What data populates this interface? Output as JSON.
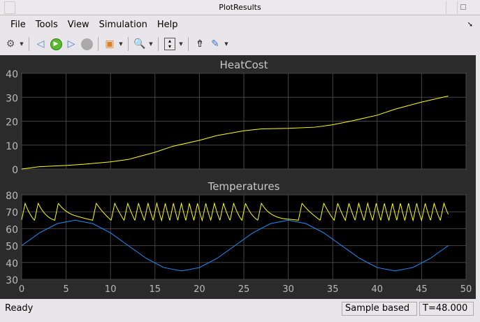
{
  "window": {
    "title": "PlotResults"
  },
  "menu": [
    "File",
    "Tools",
    "View",
    "Simulation",
    "Help"
  ],
  "toolbar": {
    "icons": [
      "gear-icon",
      "step-back-icon",
      "run-icon",
      "step-forward-icon",
      "stop-icon",
      "highlight-block-icon",
      "zoom-in-icon",
      "fit-axes-icon",
      "write-to-workspace-icon",
      "measure-icon"
    ]
  },
  "status": {
    "state": "Ready",
    "mode": "Sample based",
    "time": "T=48.000"
  },
  "colors": {
    "background": "#2b2b2b",
    "axes": "#000000",
    "heatcost": "#ffff00",
    "indoor": "#ffff00",
    "outdoor": "#1e90ff"
  },
  "chart_data": [
    {
      "type": "line",
      "title": "HeatCost",
      "xlim": [
        0,
        50
      ],
      "ylim": [
        0,
        40
      ],
      "xticks": [
        0,
        5,
        10,
        15,
        20,
        25,
        30,
        35,
        40,
        45,
        50
      ],
      "yticks": [
        0,
        10,
        20,
        30,
        40
      ],
      "grid": true,
      "series": [
        {
          "color": "#ffff00",
          "x": [
            0,
            2,
            5,
            7,
            10,
            12,
            13,
            15,
            17,
            20,
            22,
            25,
            27,
            30,
            33,
            35,
            37,
            40,
            42,
            45,
            48
          ],
          "y": [
            0,
            1,
            1.5,
            2,
            3,
            4,
            5,
            7,
            9.5,
            12,
            14,
            16,
            16.8,
            17,
            17.5,
            18.5,
            20,
            22.5,
            25,
            28,
            30.5
          ]
        }
      ]
    },
    {
      "type": "line",
      "title": "Temperatures",
      "xlim": [
        0,
        50
      ],
      "ylim": [
        30,
        80
      ],
      "xticks": [
        0,
        5,
        10,
        15,
        20,
        25,
        30,
        35,
        40,
        45,
        50
      ],
      "yticks": [
        30,
        40,
        50,
        60,
        70,
        80
      ],
      "grid": true,
      "series": [
        {
          "color": "#1e90ff",
          "x": [
            0,
            2,
            4,
            6,
            8,
            10,
            12,
            14,
            16,
            18,
            20,
            22,
            24,
            26,
            28,
            30,
            32,
            34,
            36,
            38,
            40,
            42,
            44,
            46,
            48
          ],
          "y": [
            50,
            57.5,
            63,
            65,
            63,
            57.5,
            50,
            42.5,
            37,
            35,
            37,
            42.5,
            50,
            57.5,
            63,
            65,
            63,
            57.5,
            50,
            42.5,
            37,
            35,
            37,
            42.5,
            50
          ]
        },
        {
          "color": "#ffff00",
          "behavior": "sawtooth between thermostat limits",
          "ylim_band": [
            65,
            75
          ]
        }
      ]
    }
  ]
}
